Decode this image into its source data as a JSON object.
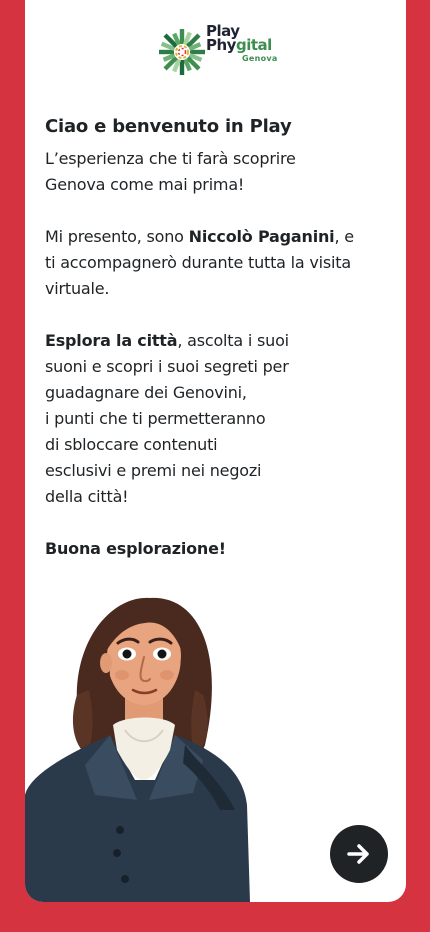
{
  "brand": {
    "name_line1": "Play",
    "name_line2_part1": "Phy",
    "name_line2_part2": "gital",
    "subname": "Genova"
  },
  "intro": {
    "title": "Ciao e benvenuto in Play",
    "subtitle_l1": "L’esperienza che ti farà scoprire",
    "subtitle_l2": "Genova come mai prima!",
    "p2_pre": "Mi presento, sono ",
    "p2_bold": "Niccolò Paganini",
    "p2_post_l1": ", e",
    "p2_l2": "ti accompagnerò durante tutta la visita",
    "p2_l3": "virtuale.",
    "p3_bold": "Esplora la città",
    "p3_post_l1": ", ascolta i suoi",
    "p3_l2": "suoni e scopri i suoi segreti per",
    "p3_l3": "guadagnare dei Genovini,",
    "p3_l4": "i punti che ti permetteranno",
    "p3_l5": "di sbloccare contenuti",
    "p3_l6": "esclusivi e premi nei negozi",
    "p3_l7": "della città!",
    "closing": "Buona esplorazione!"
  },
  "character": {
    "name": "Niccolò Paganini",
    "illustration": "paganini-illustration"
  },
  "actions": {
    "next_icon": "arrow-right-icon"
  },
  "colors": {
    "background": "#d4333f",
    "card": "#ffffff",
    "text": "#1f2326",
    "button": "#1f2326",
    "brand_green": "#3e8e4f"
  }
}
